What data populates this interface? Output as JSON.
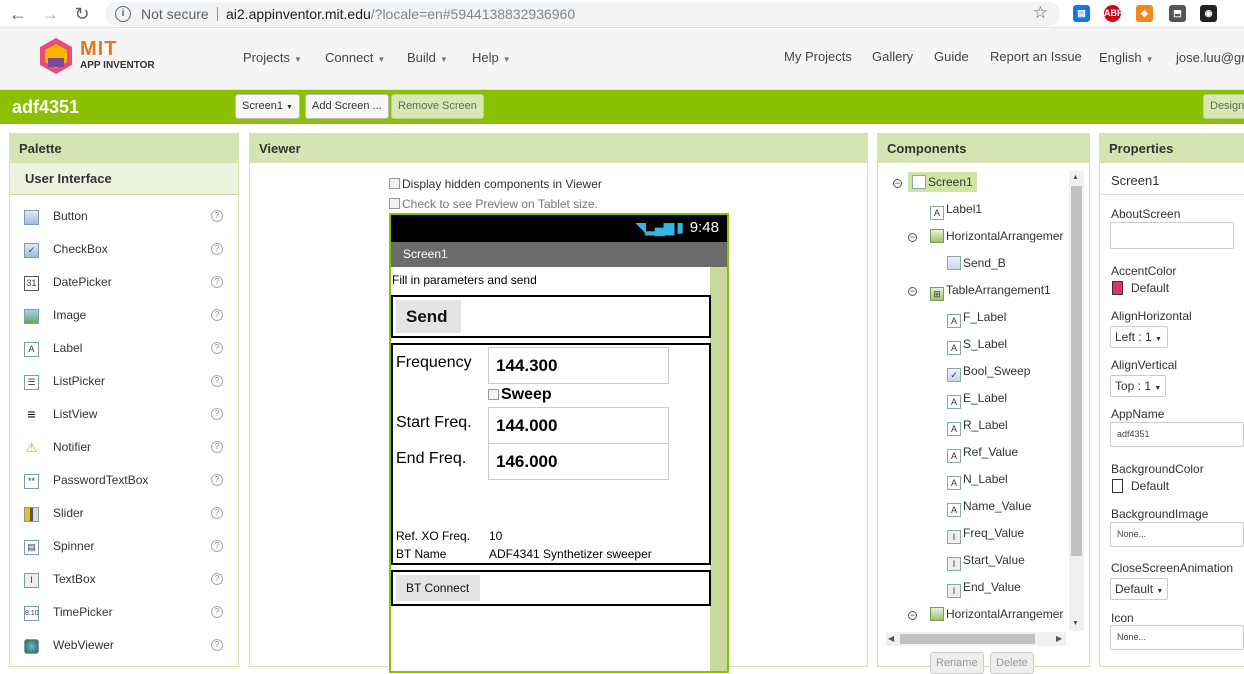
{
  "browser": {
    "security": "Not secure",
    "url_host": "ai2.appinventor.mit.edu",
    "url_path": "/?locale=en#5944138832936960"
  },
  "topbar": {
    "logo_title": "MIT",
    "logo_subtitle": "APP INVENTOR",
    "menus": [
      "Projects",
      "Connect",
      "Build",
      "Help"
    ],
    "right_links": [
      "My Projects",
      "Gallery",
      "Guide",
      "Report an Issue"
    ],
    "language": "English",
    "user": "jose.luu@gm"
  },
  "toolbar": {
    "project_name": "adf4351",
    "screen_select": "Screen1",
    "add_screen": "Add Screen ...",
    "remove_screen": "Remove Screen",
    "designer": "Designer"
  },
  "palette": {
    "title": "Palette",
    "category": "User Interface",
    "items": [
      "Button",
      "CheckBox",
      "DatePicker",
      "Image",
      "Label",
      "ListPicker",
      "ListView",
      "Notifier",
      "PasswordTextBox",
      "Slider",
      "Spinner",
      "TextBox",
      "TimePicker",
      "WebViewer"
    ]
  },
  "viewer": {
    "title": "Viewer",
    "hidden_components": "Display hidden components in Viewer",
    "tablet_preview": "Check to see Preview on Tablet size.",
    "status_time": "9:48",
    "screen_title": "Screen1",
    "intro": "Fill in parameters and send",
    "send_button": "Send",
    "freq_label": "Frequency",
    "freq_value": "144.300",
    "sweep_label": "Sweep",
    "start_label": "Start Freq.",
    "start_value": "144.000",
    "end_label": "End Freq.",
    "end_value": "146.000",
    "ref_label": "Ref. XO Freq.",
    "ref_value": "10",
    "name_label": "BT Name",
    "name_value": "ADF4341 Synthetizer sweeper",
    "bt_button": "BT Connect"
  },
  "components": {
    "title": "Components",
    "tree": [
      "Screen1",
      "Label1",
      "HorizontalArrangemer",
      "Send_B",
      "TableArrangement1",
      "F_Label",
      "S_Label",
      "Bool_Sweep",
      "E_Label",
      "R_Label",
      "Ref_Value",
      "N_Label",
      "Name_Value",
      "Freq_Value",
      "Start_Value",
      "End_Value",
      "HorizontalArrangemer"
    ],
    "rename": "Rename",
    "delete": "Delete"
  },
  "properties": {
    "title": "Properties",
    "subject": "Screen1",
    "about_screen": "AboutScreen",
    "accent_color": "AccentColor",
    "accent_value": "Default",
    "accent_swatch": "#e8306a",
    "align_h": "AlignHorizontal",
    "align_h_value": "Left : 1",
    "align_v": "AlignVertical",
    "align_v_value": "Top : 1",
    "app_name": "AppName",
    "app_name_value": "adf4351",
    "bg_color": "BackgroundColor",
    "bg_value": "Default",
    "bg_image": "BackgroundImage",
    "bg_image_value": "None...",
    "close_anim": "CloseScreenAnimation",
    "close_anim_value": "Default",
    "icon": "Icon",
    "icon_value": "None..."
  }
}
